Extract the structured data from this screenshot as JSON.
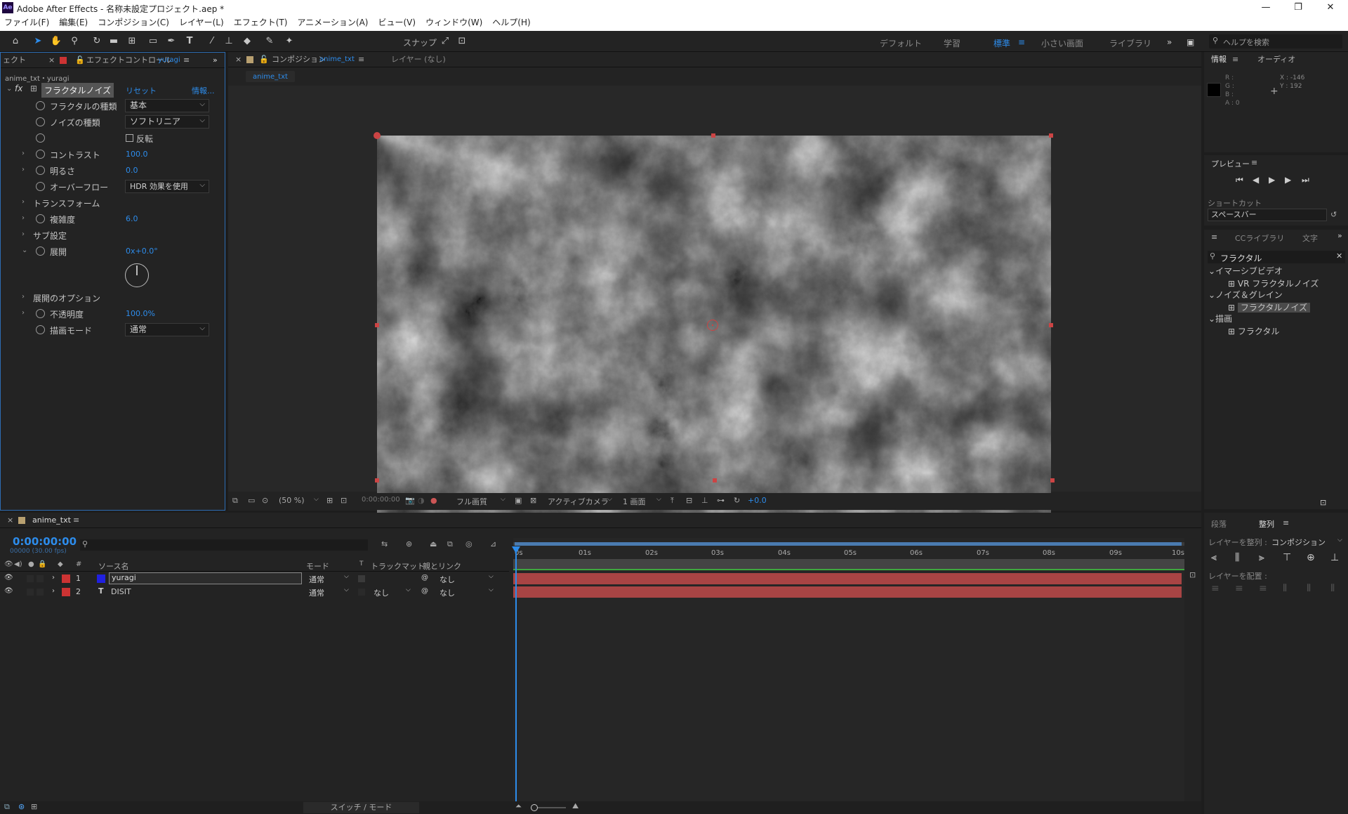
{
  "titlebar": {
    "app_icon": "Ae",
    "title": "Adobe After Effects - 名称未設定プロジェクト.aep *",
    "minimize": "—",
    "maximize": "❐",
    "close": "✕"
  },
  "menu": [
    "ファイル(F)",
    "編集(E)",
    "コンポジション(C)",
    "レイヤー(L)",
    "エフェクト(T)",
    "アニメーション(A)",
    "ビュー(V)",
    "ウィンドウ(W)",
    "ヘルプ(H)"
  ],
  "toolbar": {
    "snap_label": "スナップ",
    "workspaces": [
      "デフォルト",
      "学習",
      "標準",
      "小さい画面",
      "ライブラリ"
    ],
    "active_workspace": "標準",
    "search_placeholder": "ヘルプを検索"
  },
  "effect_panel": {
    "tab_left": "ェクト",
    "tab_title": "エフェクトコントロール",
    "tab_layer": "yuragi",
    "breadcrumb": "anime_txt・yuragi",
    "fx_label": "fx",
    "effect_name": "フラクタルノイズ",
    "reset": "リセット",
    "info": "情報...",
    "props": {
      "fractal_type": {
        "label": "フラクタルの種類",
        "value": "基本"
      },
      "noise_type": {
        "label": "ノイズの種類",
        "value": "ソフトリニア"
      },
      "invert": {
        "label": "反転"
      },
      "contrast": {
        "label": "コントラスト",
        "value": "100.0"
      },
      "brightness": {
        "label": "明るさ",
        "value": "0.0"
      },
      "overflow": {
        "label": "オーバーフロー",
        "value": "HDR 効果を使用"
      },
      "transform": {
        "label": "トランスフォーム"
      },
      "complexity": {
        "label": "複雑度",
        "value": "6.0"
      },
      "sub_settings": {
        "label": "サブ設定"
      },
      "evolution": {
        "label": "展開",
        "value": "0x+0.0°"
      },
      "evolution_options": {
        "label": "展開のオプション"
      },
      "opacity": {
        "label": "不透明度",
        "value": "100.0%"
      },
      "blend_mode": {
        "label": "描画モード",
        "value": "通常"
      }
    }
  },
  "comp_panel": {
    "tab_title": "コンポジション",
    "tab_comp": "anime_txt",
    "layer_tab": "レイヤー (なし)",
    "subtab": "anime_txt",
    "bottom": {
      "zoom": "(50 %)",
      "timecode": "0:00:00:00",
      "resolution": "フル画質",
      "camera": "アクティブカメラ",
      "views": "1 画面",
      "exposure": "+0.0"
    }
  },
  "info_panel": {
    "tab_info": "情報",
    "tab_audio": "オーディオ",
    "r": "R :",
    "g": "G :",
    "b": "B :",
    "a": "A : 0",
    "x": "X : -146",
    "y": "Y : 192"
  },
  "preview_panel": {
    "title": "プレビュー",
    "shortcut_label": "ショートカット",
    "shortcut_value": "スペースバー"
  },
  "library_panel": {
    "tab_cc": "CCライブラリ",
    "tab_text": "文字",
    "search": "フラクタル",
    "groups": [
      {
        "name": "イマーシブビデオ",
        "items": [
          "VR フラクタルノイズ"
        ]
      },
      {
        "name": "ノイズ＆グレイン",
        "items": [
          "フラクタルノイズ"
        ]
      },
      {
        "name": "描画",
        "items": [
          "フラクタル"
        ]
      }
    ]
  },
  "align_panel": {
    "tab_paragraph": "段落",
    "tab_align": "整列",
    "align_to_label": "レイヤーを整列 :",
    "align_to_value": "コンポジション",
    "distribute_label": "レイヤーを配置 :"
  },
  "timeline": {
    "tab": "anime_txt",
    "timecode": "0:00:00:00",
    "fps": "00000 (30.00 fps)",
    "columns": {
      "source": "ソース名",
      "mode": "モード",
      "t": "T",
      "trackmatte": "トラックマット",
      "parent": "親とリンク"
    },
    "layers": [
      {
        "num": "1",
        "name": "yuragi",
        "mode": "通常",
        "matte": "",
        "parent": "なし",
        "color": "#2020e0"
      },
      {
        "num": "2",
        "name": "DISIT",
        "mode": "通常",
        "matte": "なし",
        "parent": "なし",
        "type": "T"
      }
    ],
    "ruler": [
      "0s",
      "01s",
      "02s",
      "03s",
      "04s",
      "05s",
      "06s",
      "07s",
      "08s",
      "09s",
      "10s"
    ],
    "footer": "スイッチ / モード"
  }
}
